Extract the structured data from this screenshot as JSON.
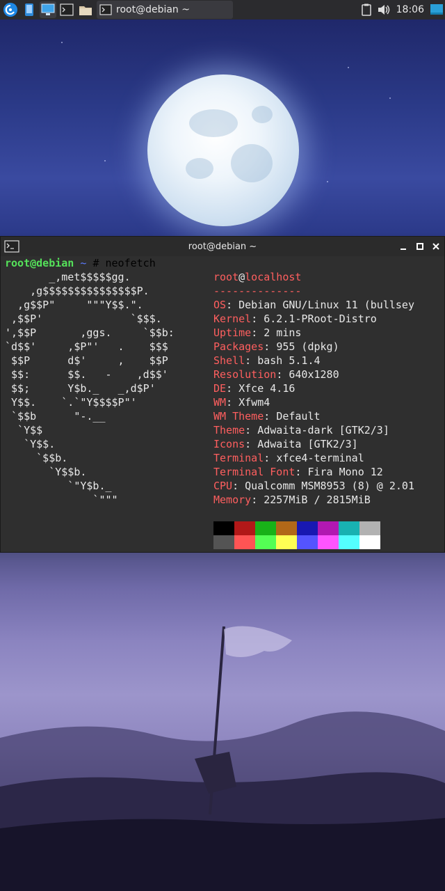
{
  "panel": {
    "launchers": [
      {
        "icon": "debian-menu-icon"
      },
      {
        "icon": "phone-icon"
      },
      {
        "icon": "desktop-icon"
      },
      {
        "icon": "terminal-icon"
      },
      {
        "icon": "folder-icon"
      }
    ],
    "task_title": "root@debian ~",
    "clock": "18:06"
  },
  "terminal": {
    "title": "root@debian ~",
    "prompt_user": "root@debian",
    "prompt_path": "~",
    "prompt_symbol": "#",
    "command": "neofetch",
    "art_lines": [
      "       _,met$$$$$gg.",
      "    ,g$$$$$$$$$$$$$$$P.",
      "  ,g$$P\"     \"\"\"Y$$.\".",
      " ,$$P'              `$$$.",
      "',$$P       ,ggs.     `$$b:",
      "`d$$'     ,$P\"'   .    $$$",
      " $$P      d$'     ,    $$P",
      " $$:      $$.   -    ,d$$'",
      " $$;      Y$b._   _,d$P'",
      " Y$$.    `.`\"Y$$$$P\"'",
      " `$$b      \"-.__",
      "  `Y$$",
      "   `Y$$.",
      "     `$$b.",
      "       `Y$$b.",
      "          `\"Y$b._",
      "              `\"\"\""
    ],
    "info": {
      "user": "root",
      "at": "@",
      "host": "localhost",
      "separator": "--------------",
      "rows": [
        {
          "key": "OS",
          "value": "Debian GNU/Linux 11 (bullsey"
        },
        {
          "key": "Kernel",
          "value": "6.2.1-PRoot-Distro"
        },
        {
          "key": "Uptime",
          "value": "2 mins"
        },
        {
          "key": "Packages",
          "value": "955 (dpkg)"
        },
        {
          "key": "Shell",
          "value": "bash 5.1.4"
        },
        {
          "key": "Resolution",
          "value": "640x1280"
        },
        {
          "key": "DE",
          "value": "Xfce 4.16"
        },
        {
          "key": "WM",
          "value": "Xfwm4"
        },
        {
          "key": "WM Theme",
          "value": "Default"
        },
        {
          "key": "Theme",
          "value": "Adwaita-dark [GTK2/3]"
        },
        {
          "key": "Icons",
          "value": "Adwaita [GTK2/3]"
        },
        {
          "key": "Terminal",
          "value": "xfce4-terminal"
        },
        {
          "key": "Terminal Font",
          "value": "Fira Mono 12"
        },
        {
          "key": "CPU",
          "value": "Qualcomm MSM8953 (8) @ 2.01"
        },
        {
          "key": "Memory",
          "value": "2257MiB / 2815MiB"
        }
      ]
    },
    "palette_dark": [
      "#000000",
      "#b21818",
      "#18b218",
      "#b26818",
      "#1818b2",
      "#b218b2",
      "#18b2b2",
      "#b2b2b2"
    ],
    "palette_bright": [
      "#545454",
      "#ff5454",
      "#54ff54",
      "#ffff54",
      "#5454ff",
      "#ff54ff",
      "#54ffff",
      "#ffffff"
    ]
  }
}
